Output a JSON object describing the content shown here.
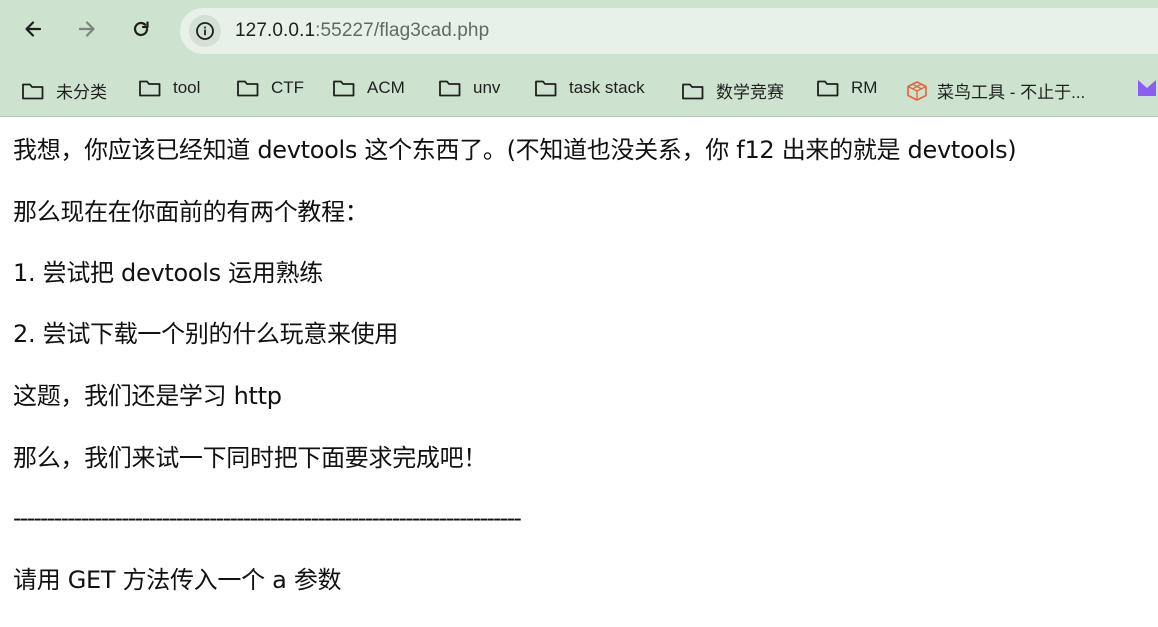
{
  "browser": {
    "url_host": "127.0.0.1",
    "url_rest": ":55227/flag3cad.php",
    "back_icon": "arrow-left-icon",
    "forward_icon": "arrow-right-icon",
    "reload_icon": "reload-icon",
    "site_info_icon": "info-icon"
  },
  "bookmarks": [
    {
      "label": "未分类",
      "icon": "folder-icon"
    },
    {
      "label": "tool",
      "icon": "folder-icon"
    },
    {
      "label": "CTF",
      "icon": "folder-icon"
    },
    {
      "label": "ACM",
      "icon": "folder-icon"
    },
    {
      "label": "unv",
      "icon": "folder-icon"
    },
    {
      "label": "task stack",
      "icon": "folder-icon"
    },
    {
      "label": "数学竞赛",
      "icon": "folder-icon"
    },
    {
      "label": "RM",
      "icon": "folder-icon"
    },
    {
      "label": "菜鸟工具 - 不止于...",
      "icon": "runoob-logo-icon"
    }
  ],
  "page": {
    "lines": [
      "我想，你应该已经知道 devtools 这个东西了。(不知道也没关系，你 f12 出来的就是 devtools)",
      "那么现在在你面前的有两个教程：",
      "1. 尝试把 devtools 运用熟练",
      "2. 尝试下载一个别的什么玩意来使用",
      "这题，我们还是学习 http",
      "那么，我们来试一下同时把下面要求完成吧！",
      "---------------------------------------------------------------------------",
      "请用 GET 方法传入一个 a 参数"
    ]
  },
  "colors": {
    "chrome_bg": "#cde3cf",
    "omnibox_bg": "#e8f1e9",
    "runoob_logo": "#e8613c",
    "extension_icon": "#8b5cf6"
  }
}
